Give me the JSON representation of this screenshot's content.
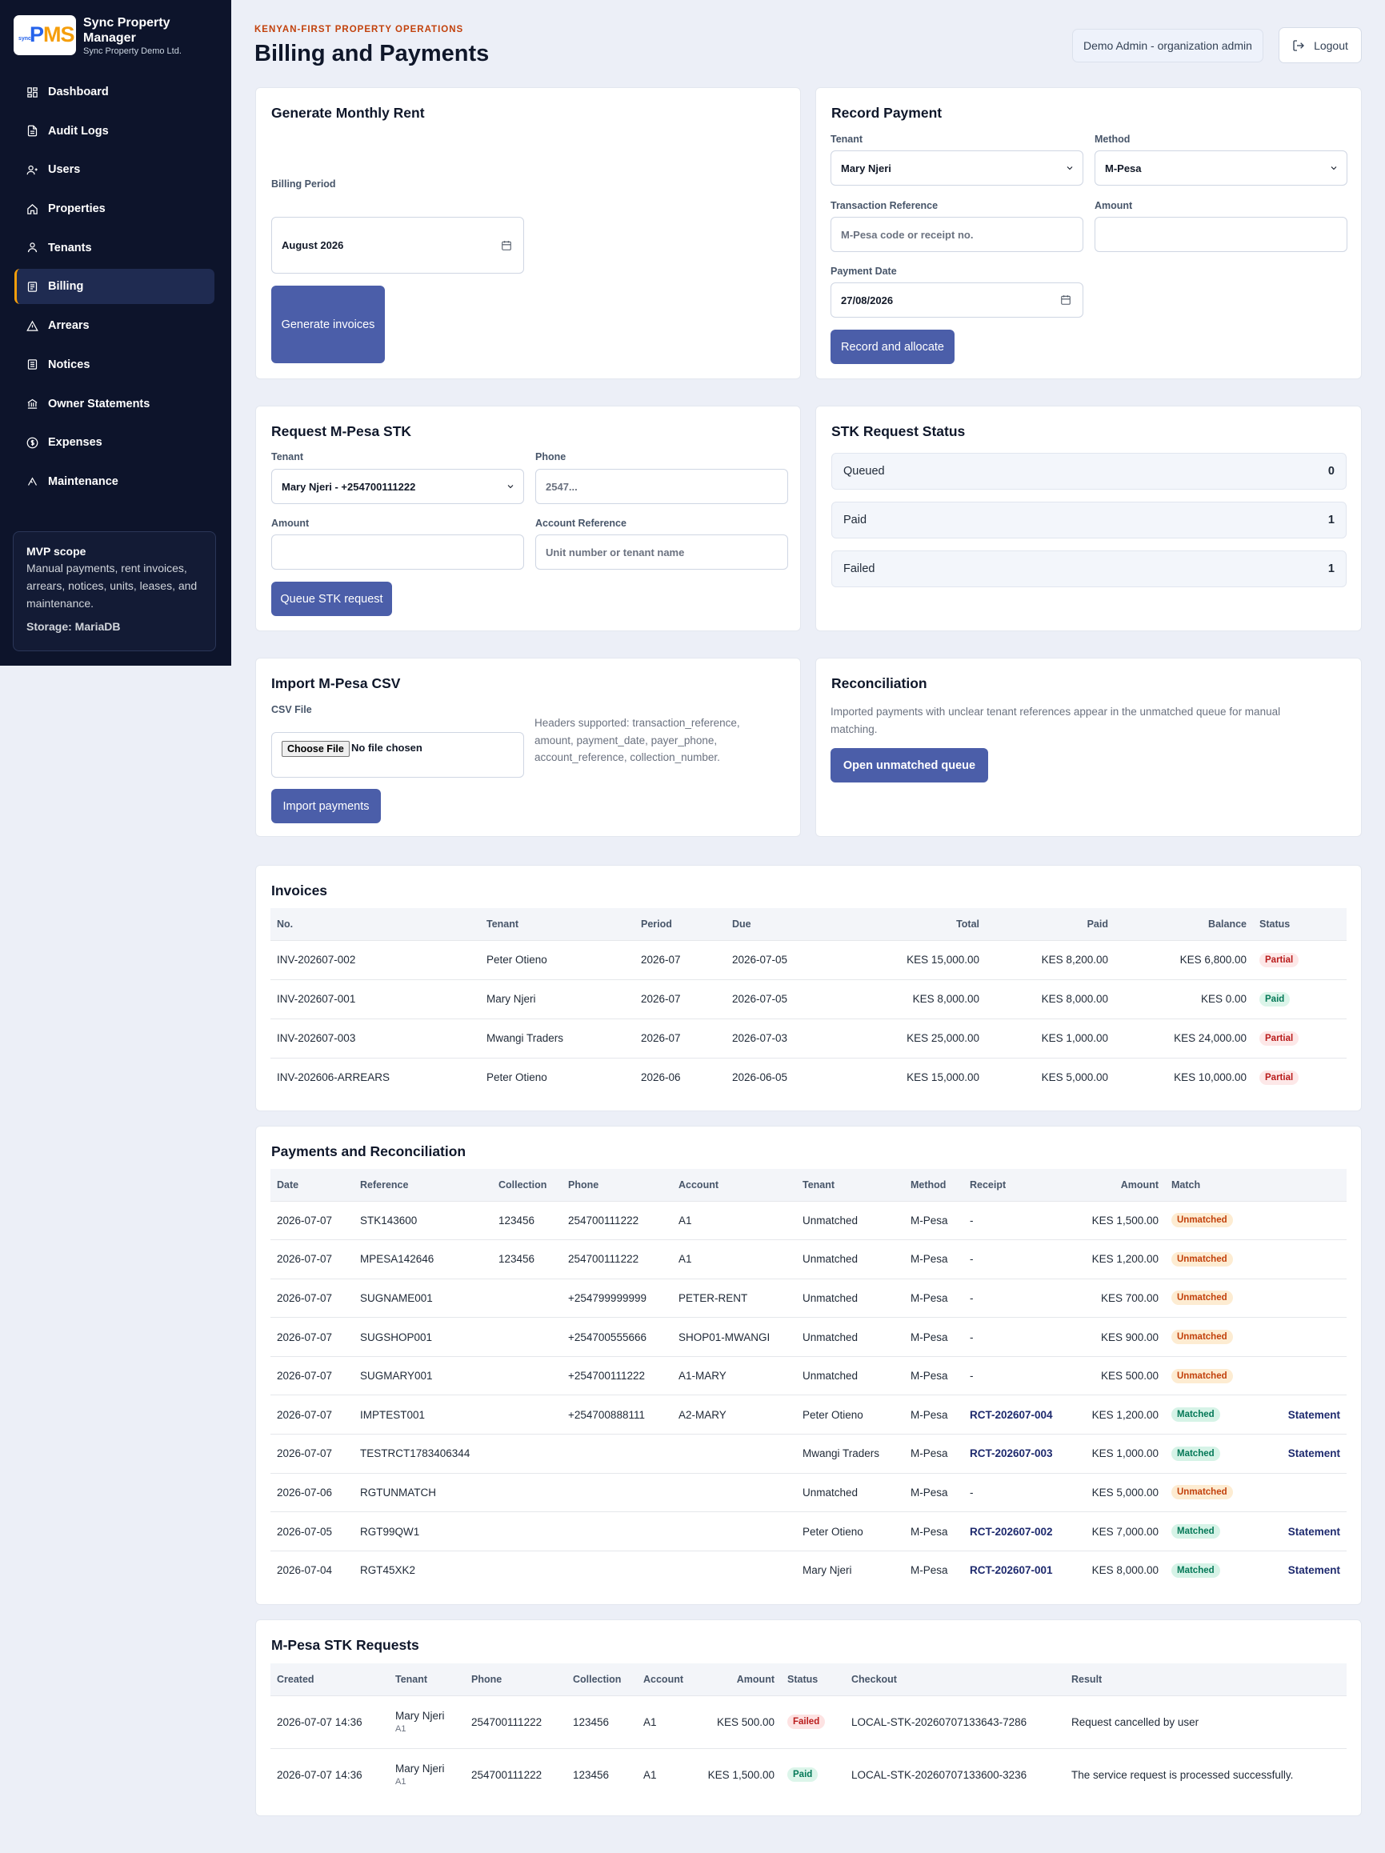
{
  "sidebar": {
    "brand_name": "Sync Property Manager",
    "brand_sub": "Sync Property Demo Ltd.",
    "logo_text_p": "P",
    "logo_text_ms": "MS",
    "logo_tiny": "sync",
    "items": [
      {
        "label": "Dashboard",
        "icon": "dashboard-icon"
      },
      {
        "label": "Audit Logs",
        "icon": "file-icon"
      },
      {
        "label": "Users",
        "icon": "users-icon"
      },
      {
        "label": "Properties",
        "icon": "home-icon"
      },
      {
        "label": "Tenants",
        "icon": "user-icon"
      },
      {
        "label": "Billing",
        "icon": "receipt-icon"
      },
      {
        "label": "Arrears",
        "icon": "warning-icon"
      },
      {
        "label": "Notices",
        "icon": "notice-icon"
      },
      {
        "label": "Owner Statements",
        "icon": "bank-icon"
      },
      {
        "label": "Expenses",
        "icon": "dollar-icon"
      },
      {
        "label": "Maintenance",
        "icon": "wrench-icon"
      }
    ],
    "active": "Billing",
    "scope": {
      "title": "MVP scope",
      "text": "Manual payments, rent invoices, arrears, notices, units, leases, and maintenance.",
      "storage": "Storage: MariaDB"
    }
  },
  "header": {
    "kicker": "KENYAN-FIRST PROPERTY OPERATIONS",
    "title": "Billing and Payments",
    "user": "Demo Admin - organization admin",
    "logout": "Logout"
  },
  "generate": {
    "title": "Generate Monthly Rent",
    "period_label": "Billing Period",
    "period_value": "August 2026",
    "button": "Generate invoices"
  },
  "record": {
    "title": "Record Payment",
    "tenant_label": "Tenant",
    "tenant_value": "Mary Njeri",
    "method_label": "Method",
    "method_value": "M-Pesa",
    "ref_label": "Transaction Reference",
    "ref_placeholder": "M-Pesa code or receipt no.",
    "amount_label": "Amount",
    "date_label": "Payment Date",
    "date_value": "27/08/2026",
    "button": "Record and allocate"
  },
  "stk_form": {
    "title": "Request M-Pesa STK",
    "tenant_label": "Tenant",
    "tenant_value": "Mary Njeri - +254700111222",
    "phone_label": "Phone",
    "phone_placeholder": "2547...",
    "amount_label": "Amount",
    "account_label": "Account Reference",
    "account_placeholder": "Unit number or tenant name",
    "button": "Queue STK request"
  },
  "stk_status": {
    "title": "STK Request Status",
    "items": [
      {
        "label": "Queued",
        "count": "0"
      },
      {
        "label": "Paid",
        "count": "1"
      },
      {
        "label": "Failed",
        "count": "1"
      }
    ]
  },
  "import": {
    "title": "Import M-Pesa CSV",
    "file_label": "CSV File",
    "choose": "Choose File",
    "no_file": "No file chosen",
    "hint": "Headers supported: transaction_reference, amount, payment_date, payer_phone, account_reference, collection_number.",
    "button": "Import payments"
  },
  "recon": {
    "title": "Reconciliation",
    "text": "Imported payments with unclear tenant references appear in the unmatched queue for manual matching.",
    "button": "Open unmatched queue"
  },
  "invoices": {
    "title": "Invoices",
    "headers": [
      "No.",
      "Tenant",
      "Period",
      "Due",
      "Total",
      "Paid",
      "Balance",
      "Status"
    ],
    "rows": [
      [
        "INV-202607-002",
        "Peter Otieno",
        "2026-07",
        "2026-07-05",
        "KES 15,000.00",
        "KES 8,200.00",
        "KES 6,800.00",
        "Partial"
      ],
      [
        "INV-202607-001",
        "Mary Njeri",
        "2026-07",
        "2026-07-05",
        "KES 8,000.00",
        "KES 8,000.00",
        "KES 0.00",
        "Paid"
      ],
      [
        "INV-202607-003",
        "Mwangi Traders",
        "2026-07",
        "2026-07-03",
        "KES 25,000.00",
        "KES 1,000.00",
        "KES 24,000.00",
        "Partial"
      ],
      [
        "INV-202606-ARREARS",
        "Peter Otieno",
        "2026-06",
        "2026-06-05",
        "KES 15,000.00",
        "KES 5,000.00",
        "KES 10,000.00",
        "Partial"
      ]
    ]
  },
  "payments": {
    "title": "Payments and Reconciliation",
    "headers": [
      "Date",
      "Reference",
      "Collection",
      "Phone",
      "Account",
      "Tenant",
      "Method",
      "Receipt",
      "Amount",
      "Match",
      ""
    ],
    "rows": [
      [
        "2026-07-07",
        "STK143600",
        "123456",
        "254700111222",
        "A1",
        "Unmatched",
        "M-Pesa",
        "-",
        "KES 1,500.00",
        "Unmatched",
        ""
      ],
      [
        "2026-07-07",
        "MPESA142646",
        "123456",
        "254700111222",
        "A1",
        "Unmatched",
        "M-Pesa",
        "-",
        "KES 1,200.00",
        "Unmatched",
        ""
      ],
      [
        "2026-07-07",
        "SUGNAME001",
        "",
        "+254799999999",
        "PETER-RENT",
        "Unmatched",
        "M-Pesa",
        "-",
        "KES 700.00",
        "Unmatched",
        ""
      ],
      [
        "2026-07-07",
        "SUGSHOP001",
        "",
        "+254700555666",
        "SHOP01-MWANGI",
        "Unmatched",
        "M-Pesa",
        "-",
        "KES 900.00",
        "Unmatched",
        ""
      ],
      [
        "2026-07-07",
        "SUGMARY001",
        "",
        "+254700111222",
        "A1-MARY",
        "Unmatched",
        "M-Pesa",
        "-",
        "KES 500.00",
        "Unmatched",
        ""
      ],
      [
        "2026-07-07",
        "IMPTEST001",
        "",
        "+254700888111",
        "A2-MARY",
        "Peter Otieno",
        "M-Pesa",
        "RCT-202607-004",
        "KES 1,200.00",
        "Matched",
        "Statement"
      ],
      [
        "2026-07-07",
        "TESTRCT1783406344",
        "",
        "",
        "",
        "Mwangi Traders",
        "M-Pesa",
        "RCT-202607-003",
        "KES 1,000.00",
        "Matched",
        "Statement"
      ],
      [
        "2026-07-06",
        "RGTUNMATCH",
        "",
        "",
        "",
        "Unmatched",
        "M-Pesa",
        "-",
        "KES 5,000.00",
        "Unmatched",
        ""
      ],
      [
        "2026-07-05",
        "RGT99QW1",
        "",
        "",
        "",
        "Peter Otieno",
        "M-Pesa",
        "RCT-202607-002",
        "KES 7,000.00",
        "Matched",
        "Statement"
      ],
      [
        "2026-07-04",
        "RGT45XK2",
        "",
        "",
        "",
        "Mary Njeri",
        "M-Pesa",
        "RCT-202607-001",
        "KES 8,000.00",
        "Matched",
        "Statement"
      ]
    ]
  },
  "stk_requests": {
    "title": "M-Pesa STK Requests",
    "headers": [
      "Created",
      "Tenant",
      "Phone",
      "Collection",
      "Account",
      "Amount",
      "Status",
      "Checkout",
      "Result"
    ],
    "rows": [
      [
        "2026-07-07 14:36",
        "Mary Njeri",
        "A1",
        "254700111222",
        "123456",
        "A1",
        "KES 500.00",
        "Failed",
        "LOCAL-STK-20260707133643-7286",
        "Request cancelled by user"
      ],
      [
        "2026-07-07 14:36",
        "Mary Njeri",
        "A1",
        "254700111222",
        "123456",
        "A1",
        "KES 1,500.00",
        "Paid",
        "LOCAL-STK-20260707133600-3236",
        "The service request is processed successfully."
      ]
    ]
  },
  "colors": {
    "sidebar_bg": "#0d142b",
    "accent": "#4b5ea9",
    "kicker": "#c2410c",
    "active_border": "#f59e0b"
  }
}
